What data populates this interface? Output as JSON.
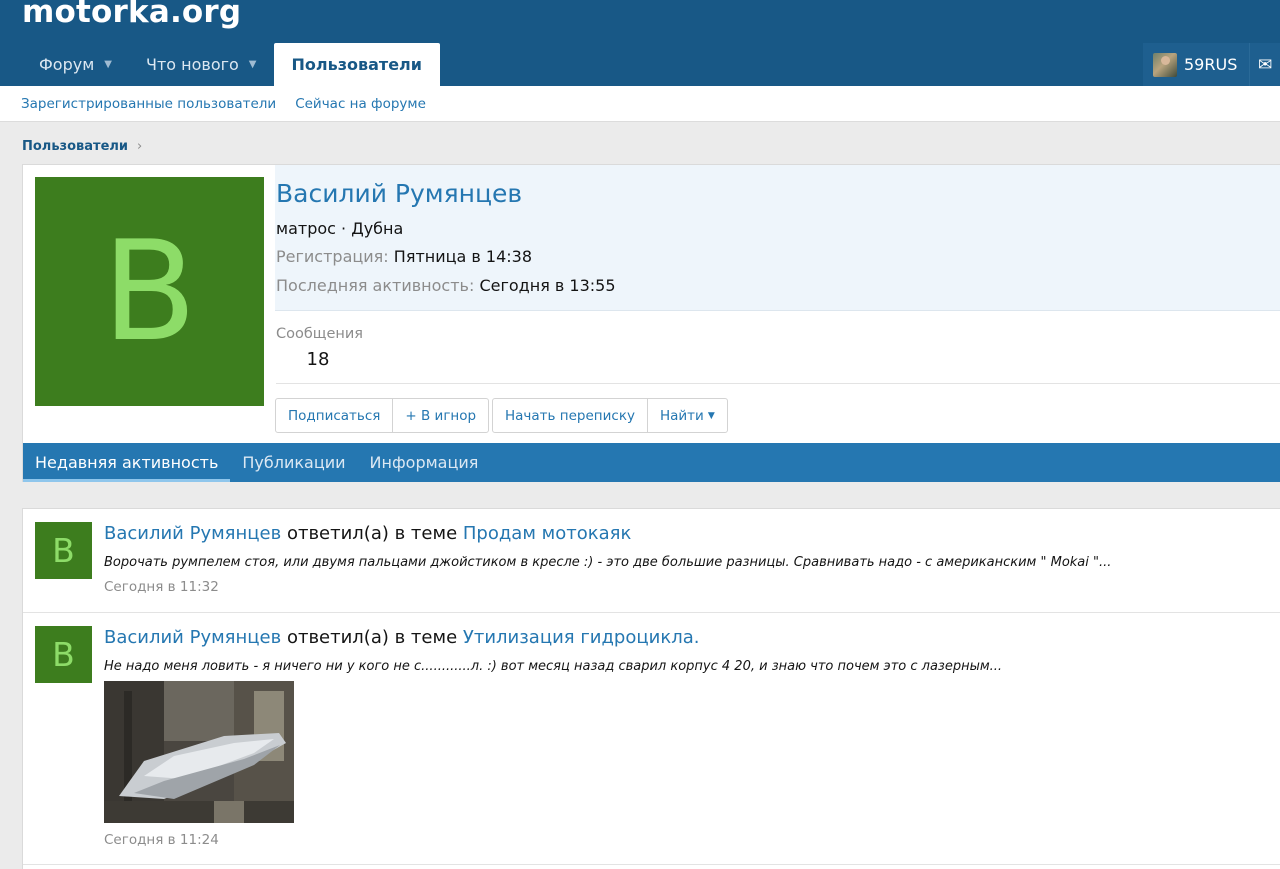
{
  "site": {
    "logo": "motorka.org"
  },
  "nav": {
    "tabs": [
      {
        "label": "Форум",
        "has_dropdown": true
      },
      {
        "label": "Что нового",
        "has_dropdown": true
      },
      {
        "label": "Пользователи",
        "active": true
      }
    ],
    "user": {
      "name": "59RUS"
    },
    "icons": {
      "mail": "envelope-icon",
      "dropdown": "caret-down-icon"
    }
  },
  "subnav": {
    "items": [
      "Зарегистрированные пользователи",
      "Сейчас на форуме"
    ]
  },
  "breadcrumb": {
    "label": "Пользователи",
    "chevron": "›"
  },
  "profile": {
    "avatar_letter": "В",
    "avatar_bg": "#3d7d1e",
    "avatar_fg": "#8ddc68",
    "name": "Василий Румянцев",
    "title": "матрос · Дубна",
    "registered_label": "Регистрация:",
    "registered_value": "Пятница в 14:38",
    "last_active_label": "Последняя активность:",
    "last_active_value": "Сегодня в 13:55",
    "stat_label": "Сообщения",
    "stat_value": "18",
    "buttons": {
      "follow": "Подписаться",
      "ignore": "+ В игнор",
      "message": "Начать переписку",
      "find": "Найти"
    }
  },
  "tabs": {
    "items": [
      "Недавняя активность",
      "Публикации",
      "Информация"
    ],
    "active_index": 0
  },
  "activity": [
    {
      "author": "Василий Румянцев",
      "action": " ответил(а) в теме ",
      "thread": "Продам мотокаяк",
      "snippet": "Ворочать румпелем стоя, или двумя пальцами джойстиком в кресле :) - это две большие разницы. Сравнивать надо - с американским \" Mokai \"...",
      "time": "Сегодня в 11:32",
      "avatar_letter": "В"
    },
    {
      "author": "Василий Румянцев",
      "action": " ответил(а) в теме ",
      "thread": "Утилизация гидроцикла.",
      "snippet": "Не надо меня ловить - я ничего ни у кого не с............л. :) вот месяц назад сварил корпус 4 20, и знаю что почем это с лазерным...",
      "time": "Сегодня в 11:24",
      "avatar_letter": "В",
      "has_image": true
    }
  ],
  "colors": {
    "header": "#185886",
    "accent": "#2577b1",
    "muted": "#8c8c8c"
  }
}
